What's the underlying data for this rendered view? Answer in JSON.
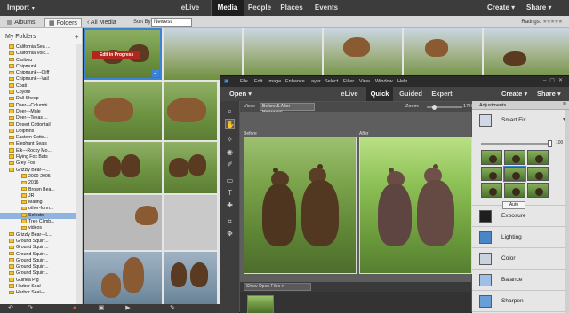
{
  "organizer": {
    "import_label": "Import",
    "tabs": [
      "eLive",
      "Media",
      "People",
      "Places",
      "Events"
    ],
    "active_tab": "Media",
    "create_label": "Create",
    "share_label": "Share",
    "albums_label": "Albums",
    "folders_label": "Folders",
    "all_media_label": "All Media",
    "sort_by_label": "Sort By:",
    "sort_value": "Newest",
    "ratings_label": "Ratings:",
    "my_folders_label": "My Folders",
    "edit_badge": "Edit in Progress",
    "folders": [
      "California Sea ...",
      "California Volc...",
      "Caribou",
      "Chipmunk",
      "Chipmunk---Cliff",
      "Chipmunk---Vail",
      "Coati",
      "Coyote",
      "Dall-Sheep",
      "Deer---Columbi...",
      "Deer---Mule",
      "Deer---Texas ...",
      "Desert Cottontail",
      "Dolphins",
      "Eastern Cotto...",
      "Elephant Seals",
      "Elk---Rocky Mo...",
      "Flying Fox Bats",
      "Grey Fox",
      "Grizzly Bear---...",
      "2000-2005",
      "2016",
      "Brown Bea...",
      "JR",
      "Mating",
      "other-form...",
      "Selects",
      "Tree Climb...",
      "videos",
      "Grizzly Bear---L...",
      "Ground Squirr...",
      "Ground Squirr...",
      "Ground Squirr...",
      "Ground Squirr...",
      "Ground Squirr...",
      "Ground Squirr...",
      "Guinea Pig",
      "Harbor Seal",
      "Harbor Seal---..."
    ],
    "selected_folder": "Selects"
  },
  "editor": {
    "menu": [
      "File",
      "Edit",
      "Image",
      "Enhance",
      "Layer",
      "Select",
      "Filter",
      "View",
      "Window",
      "Help"
    ],
    "open_label": "Open",
    "modes": [
      "eLive",
      "Quick",
      "Guided",
      "Expert"
    ],
    "active_mode": "Quick",
    "create_label": "Create",
    "share_label": "Share",
    "view_label": "View:",
    "view_value": "Before & After - Horizontal",
    "zoom_label": "Zoom:",
    "zoom_value": "17%",
    "zoom_fraction": 0.17,
    "before_label": "Before",
    "after_label": "After",
    "photobin_select": "Show Open Files",
    "panel_title": "Adjustments",
    "smart_fix_label": "Smart Fix",
    "smart_fix_value": "100",
    "auto_label": "Auto",
    "adjustments": [
      "Exposure",
      "Lighting",
      "Color",
      "Balance",
      "Sharpen"
    ]
  },
  "colors": {
    "accent": "#3a83d6",
    "edit_badge": "#b3261e",
    "folder": "#f1c232"
  },
  "icons": {
    "tools": [
      "zoom-icon",
      "hand-icon",
      "quick-selection-icon",
      "eye-icon",
      "whiten-teeth-icon",
      "straighten-icon",
      "type-icon",
      "spot-healing-icon",
      "crop-icon",
      "move-icon"
    ]
  }
}
